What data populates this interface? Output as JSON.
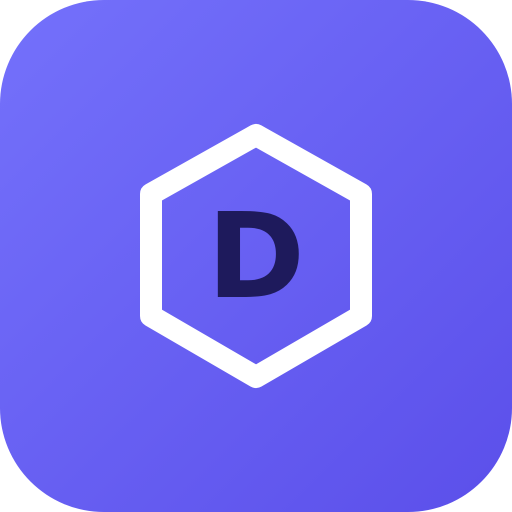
{
  "icon": {
    "letter": "D",
    "shape_icon": "hexagon-outline-icon",
    "colors": {
      "background_start": "#7471fb",
      "background_end": "#5b4fea",
      "hexagon_stroke": "#ffffff",
      "letter": "#1e1a5c"
    }
  }
}
